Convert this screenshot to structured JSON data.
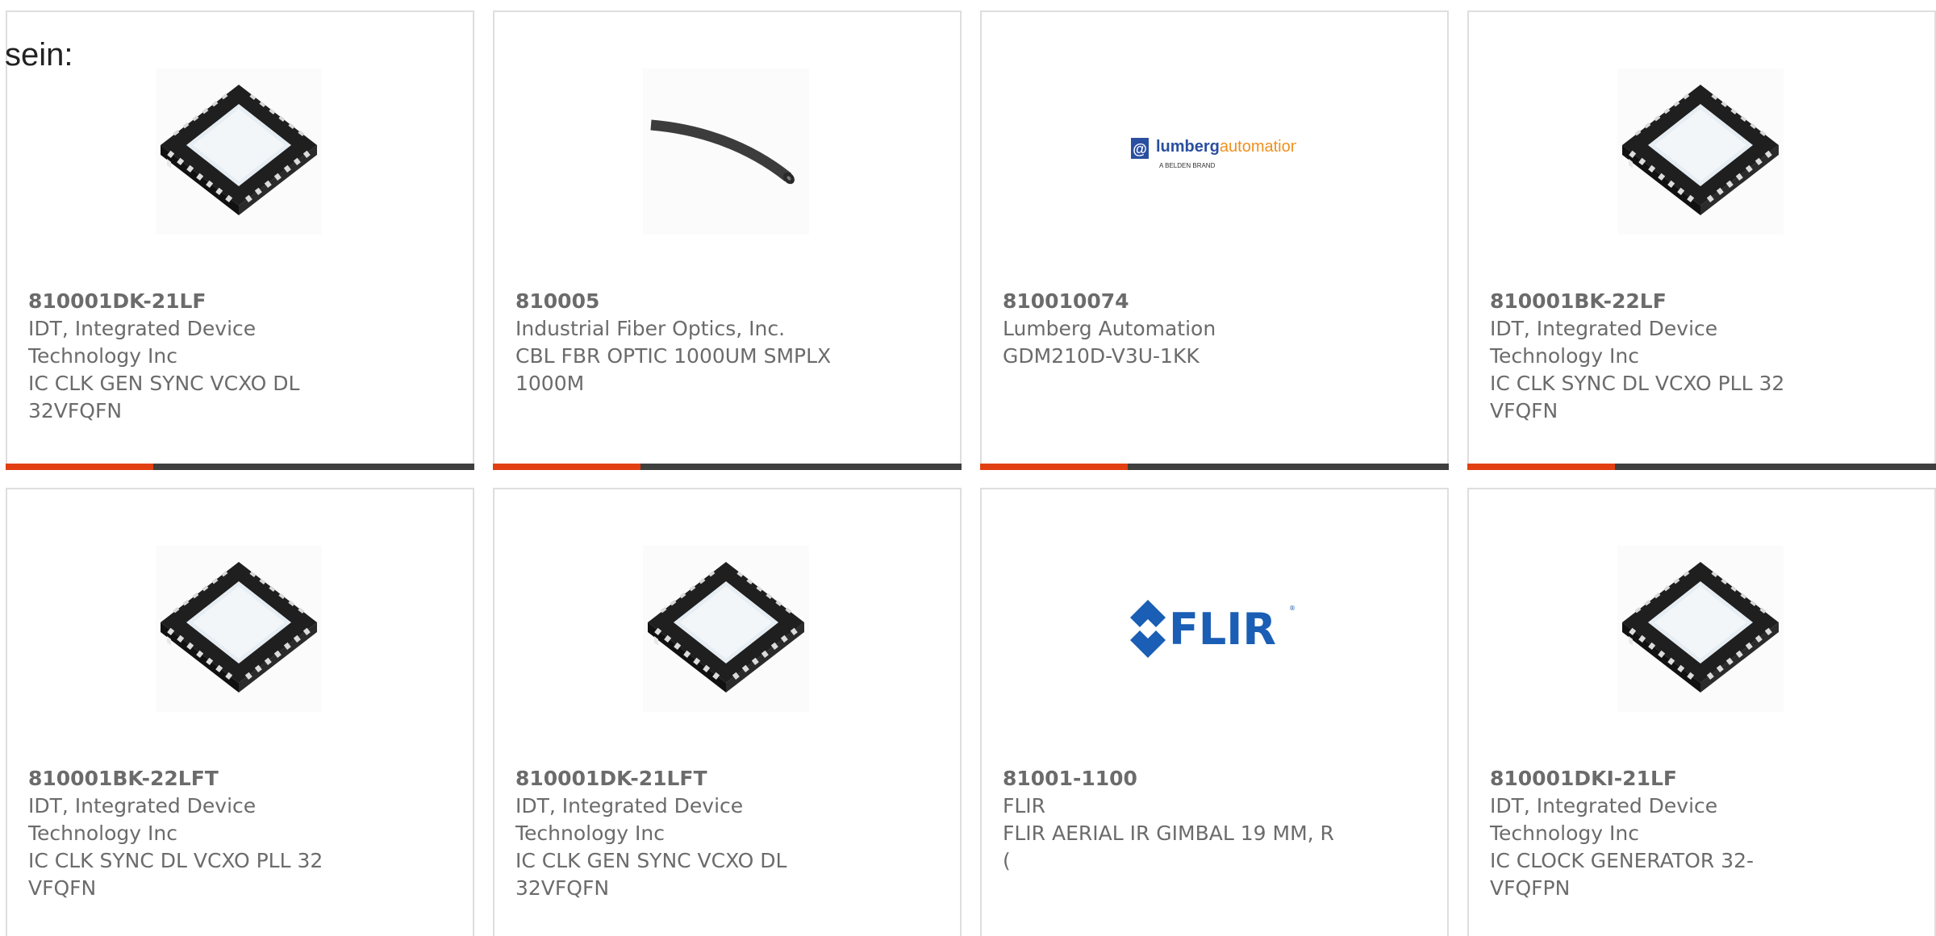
{
  "intro_text": "sein:",
  "colors": {
    "accent": "#e23f12",
    "bar_dark": "#3f3f3f",
    "text": "#6b6b6b",
    "border": "#dedede",
    "flir_blue": "#1a5eb5",
    "lumberg_blue": "#2a4fa0",
    "lumberg_orange": "#f0901e"
  },
  "products": [
    {
      "part_number": "810001DK-21LF",
      "manufacturer": "IDT, Integrated Device Technology Inc",
      "description": "IC CLK GEN SYNC VCXO DL 32VFQFN",
      "image": "qfn-chip-icon"
    },
    {
      "part_number": "810005",
      "manufacturer": "Industrial Fiber Optics, Inc.",
      "description": "CBL FBR OPTIC 1000UM SMPLX 1000M",
      "image": "fiber-cable-icon"
    },
    {
      "part_number": "810010074",
      "manufacturer": "Lumberg Automation",
      "description": "GDM210D-V3U-1KK",
      "image": "lumberg-logo",
      "logo_text_main": "lumberg",
      "logo_text_accent": "automation",
      "logo_subtext": "A BELDEN BRAND"
    },
    {
      "part_number": "810001BK-22LF",
      "manufacturer": "IDT, Integrated Device Technology Inc",
      "description": "IC CLK SYNC DL VCXO PLL 32 VFQFN",
      "image": "qfn-chip-icon"
    },
    {
      "part_number": "810001BK-22LFT",
      "manufacturer": "IDT, Integrated Device Technology Inc",
      "description": "IC CLK SYNC DL VCXO PLL 32 VFQFN",
      "image": "qfn-chip-icon"
    },
    {
      "part_number": "810001DK-21LFT",
      "manufacturer": "IDT, Integrated Device Technology Inc",
      "description": "IC CLK GEN SYNC VCXO DL 32VFQFN",
      "image": "qfn-chip-icon"
    },
    {
      "part_number": "81001-1100",
      "manufacturer": "FLIR",
      "description": "FLIR AERIAL IR GIMBAL 19 MM, R (",
      "image": "flir-logo",
      "logo_text": "FLIR"
    },
    {
      "part_number": "810001DKI-21LF",
      "manufacturer": "IDT, Integrated Device Technology Inc",
      "description": "IC CLOCK GENERATOR 32-VFQFPN",
      "image": "qfn-chip-icon"
    }
  ]
}
